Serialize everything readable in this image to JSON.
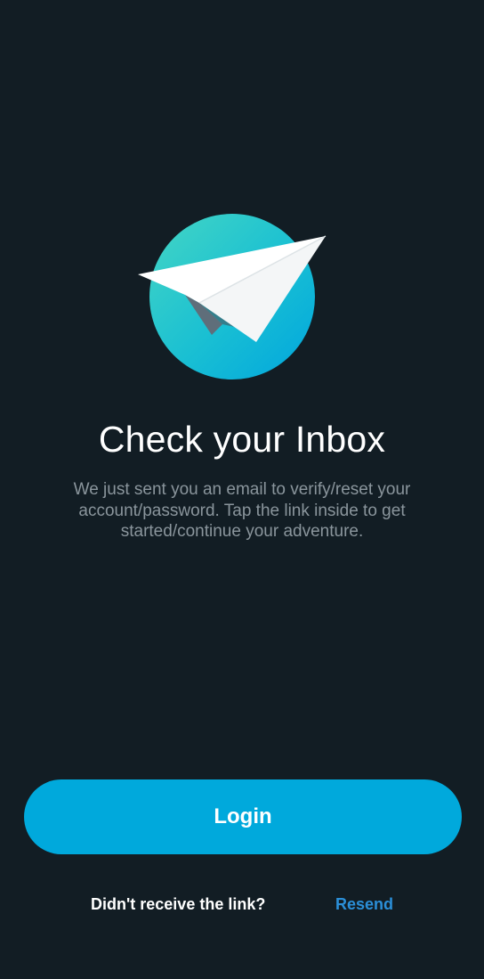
{
  "screen": {
    "illustration_icon": "paper-plane-icon",
    "title": "Check your Inbox",
    "subtitle": "We just sent you an email to verify/reset your account/password. Tap the link inside to get started/continue your adventure."
  },
  "actions": {
    "login_label": "Login",
    "resend_prompt": "Didn't receive the link?",
    "resend_label": "Resend"
  },
  "colors": {
    "background": "#121d24",
    "accent": "#00a9dc",
    "link": "#2b8fd8",
    "subtitle_text": "#8a959c",
    "circle_gradient_start": "#40d3c6",
    "circle_gradient_end": "#00a8dc"
  }
}
